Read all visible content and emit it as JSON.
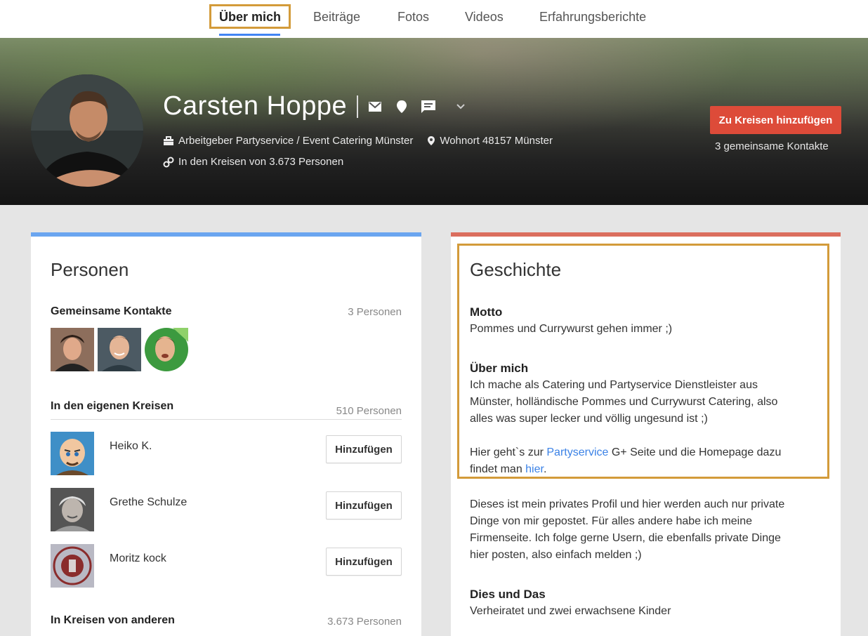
{
  "tabs": [
    {
      "label": "Über mich",
      "active": true
    },
    {
      "label": "Beiträge"
    },
    {
      "label": "Fotos"
    },
    {
      "label": "Videos"
    },
    {
      "label": "Erfahrungsberichte"
    }
  ],
  "profile": {
    "name": "Carsten Hoppe",
    "employer": "Arbeitgeber Partyservice / Event Catering Münster",
    "residence": "Wohnort 48157 Münster",
    "in_circles": "In den Kreisen von 3.673 Personen",
    "add_button": "Zu Kreisen hinzufügen",
    "shared_contacts": "3 gemeinsame Kontakte",
    "icons": [
      "mail-icon",
      "location-pin-icon",
      "message-icon",
      "chevron-down-icon"
    ]
  },
  "people": {
    "title": "Personen",
    "shared": {
      "label": "Gemeinsame Kontakte",
      "count": "3 Personen"
    },
    "own_circles": {
      "label": "In den eigenen Kreisen",
      "count": "510 Personen",
      "items": [
        {
          "name": "Heiko K.",
          "button": "Hinzufügen"
        },
        {
          "name": "Grethe Schulze",
          "button": "Hinzufügen"
        },
        {
          "name": "Moritz kock",
          "button": "Hinzufügen"
        }
      ]
    },
    "others_circles": {
      "label": "In Kreisen von anderen",
      "count": "3.673 Personen"
    }
  },
  "story": {
    "title": "Geschichte",
    "motto_label": "Motto",
    "motto_text": "Pommes und Currywurst gehen immer ;)",
    "about_label": "Über mich",
    "about_lines": [
      "Ich mache als Catering und Partyservice Dienstleister aus",
      "Münster, holländische Pommes und Currywurst Catering, also",
      "alles was super lecker und völlig ungesund ist ;)"
    ],
    "link_line1_pre": "Hier geht`s zur ",
    "link_line1_link": "Partyservice",
    "link_line1_post": " G+ Seite und die Homepage dazu",
    "link_line2_pre": "findet man ",
    "link_line2_link": "hier",
    "link_line2_post": ".",
    "private_lines": [
      "Dieses ist mein privates Profil und hier werden auch nur private",
      "Dinge von mir gepostet. Für alles andere habe ich meine",
      "Firmenseite. Ich folge gerne Usern, die ebenfalls private Dinge",
      "hier posten, also einfach melden ;)"
    ],
    "misc_label": "Dies und Das",
    "misc_text": "Verheiratet und zwei erwachsene Kinder"
  },
  "colors": {
    "accent_blue": "#4285f4",
    "button_red": "#dd4b39",
    "highlight": "#d39b3a",
    "link": "#3b82e6"
  }
}
